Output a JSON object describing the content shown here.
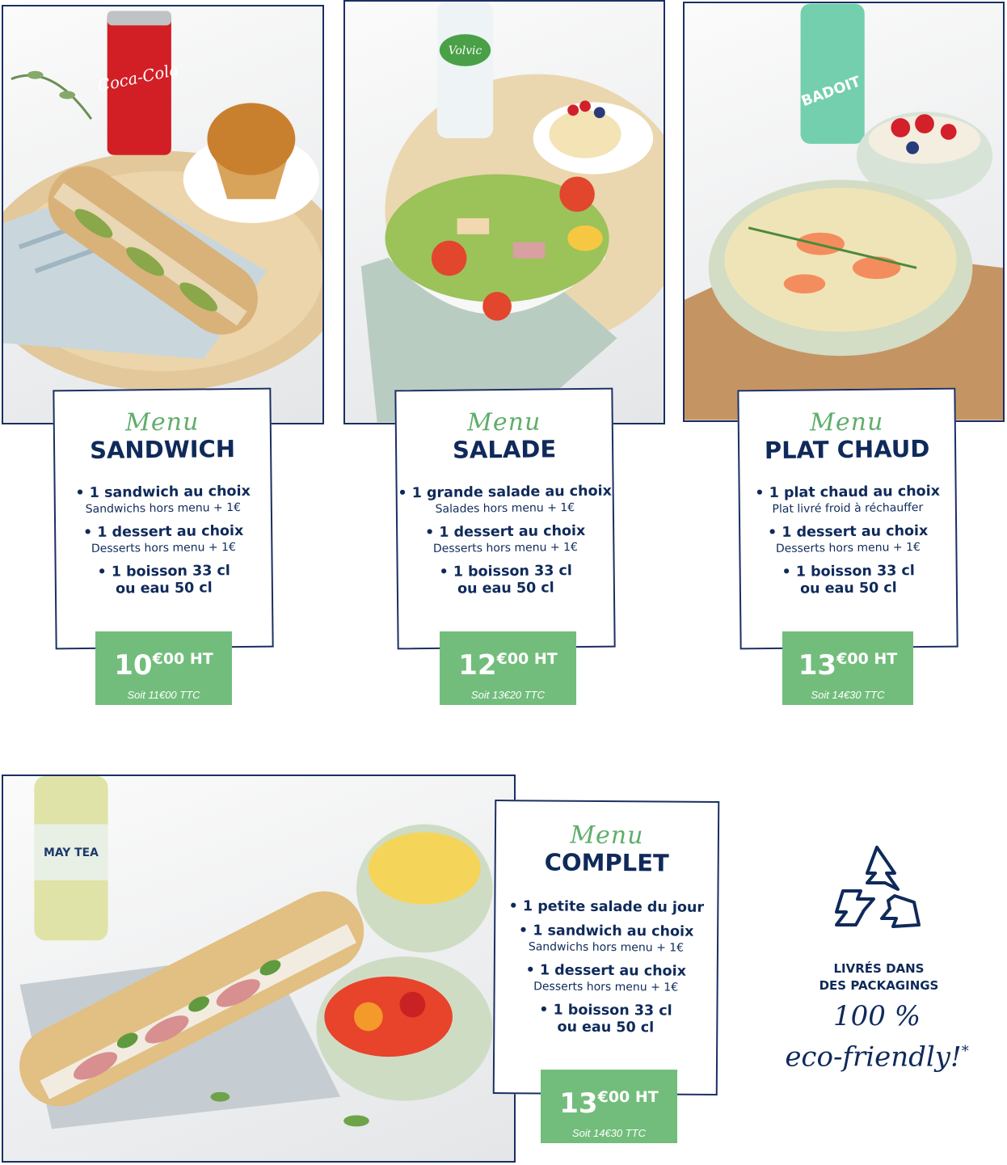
{
  "menus": [
    {
      "script": "Menu",
      "title": "SANDWICH",
      "items": [
        {
          "main": "• 1 sandwich au choix",
          "sub": "Sandwichs hors menu + 1€"
        },
        {
          "main": "• 1 dessert au choix",
          "sub": "Desserts hors menu + 1€"
        },
        {
          "main": "• 1 boisson 33 cl",
          "main2": "ou eau 50 cl"
        }
      ],
      "price_int": "10",
      "price_sup": "€00 HT",
      "price_ttc": "Soit 11€00 TTC"
    },
    {
      "script": "Menu",
      "title": "SALADE",
      "items": [
        {
          "main": "• 1 grande salade au choix",
          "sub": "Salades hors menu + 1€"
        },
        {
          "main": "• 1 dessert au choix",
          "sub": "Desserts hors menu + 1€"
        },
        {
          "main": "• 1 boisson 33 cl",
          "main2": "ou eau 50 cl"
        }
      ],
      "price_int": "12",
      "price_sup": "€00 HT",
      "price_ttc": "Soit 13€20 TTC"
    },
    {
      "script": "Menu",
      "title": "PLAT CHAUD",
      "items": [
        {
          "main": "• 1 plat chaud au choix",
          "sub": "Plat livré froid à réchauffer"
        },
        {
          "main": "• 1 dessert au choix",
          "sub": "Desserts hors menu + 1€"
        },
        {
          "main": "• 1 boisson 33 cl",
          "main2": "ou eau 50 cl"
        }
      ],
      "price_int": "13",
      "price_sup": "€00 HT",
      "price_ttc": "Soit 14€30 TTC"
    },
    {
      "script": "Menu",
      "title": "COMPLET",
      "items": [
        {
          "main": "• 1 petite salade du jour"
        },
        {
          "main": "• 1 sandwich au choix",
          "sub": "Sandwichs hors menu + 1€"
        },
        {
          "main": "• 1 dessert au choix",
          "sub": "Desserts hors menu + 1€"
        },
        {
          "main": "• 1 boisson 33 cl",
          "main2": "ou eau 50 cl"
        }
      ],
      "price_int": "13",
      "price_sup": "€00 HT",
      "price_ttc": "Soit 14€30 TTC"
    }
  ],
  "eco": {
    "line1": "LIVRÉS DANS",
    "line2": "DES PACKAGINGS",
    "script1": "100 %",
    "script2": "eco-friendly!",
    "star": "*",
    "icon": "recycle-icon"
  },
  "photos": {
    "can_label": "Coca-Cola",
    "water1_label": "Volvic",
    "water2_label": "BADOIT",
    "tea_label": "MAY TEA"
  },
  "colors": {
    "navy": "#0f2a5a",
    "green": "#72bd7c",
    "script_green": "#5fae6a",
    "border": "#1b2f63"
  }
}
